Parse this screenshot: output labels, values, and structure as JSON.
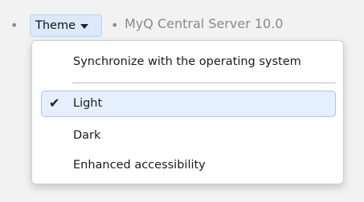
{
  "topbar": {
    "bullet_left": "•",
    "theme_button_label": "Theme",
    "bullet_right": "•",
    "server_label": "MyQ Central Server 10.0"
  },
  "menu": {
    "items": [
      {
        "label": "Synchronize with the operating system",
        "selected": false
      },
      {
        "label": "Light",
        "selected": true,
        "check_glyph": "✔"
      },
      {
        "label": "Dark",
        "selected": false
      },
      {
        "label": "Enhanced accessibility",
        "selected": false
      }
    ]
  },
  "colors": {
    "theme_button_bg": "#dbe9fb",
    "selected_item_bg": "#e6effc",
    "selected_item_border": "#a9c6ee",
    "muted_text": "#8a8a8a"
  }
}
